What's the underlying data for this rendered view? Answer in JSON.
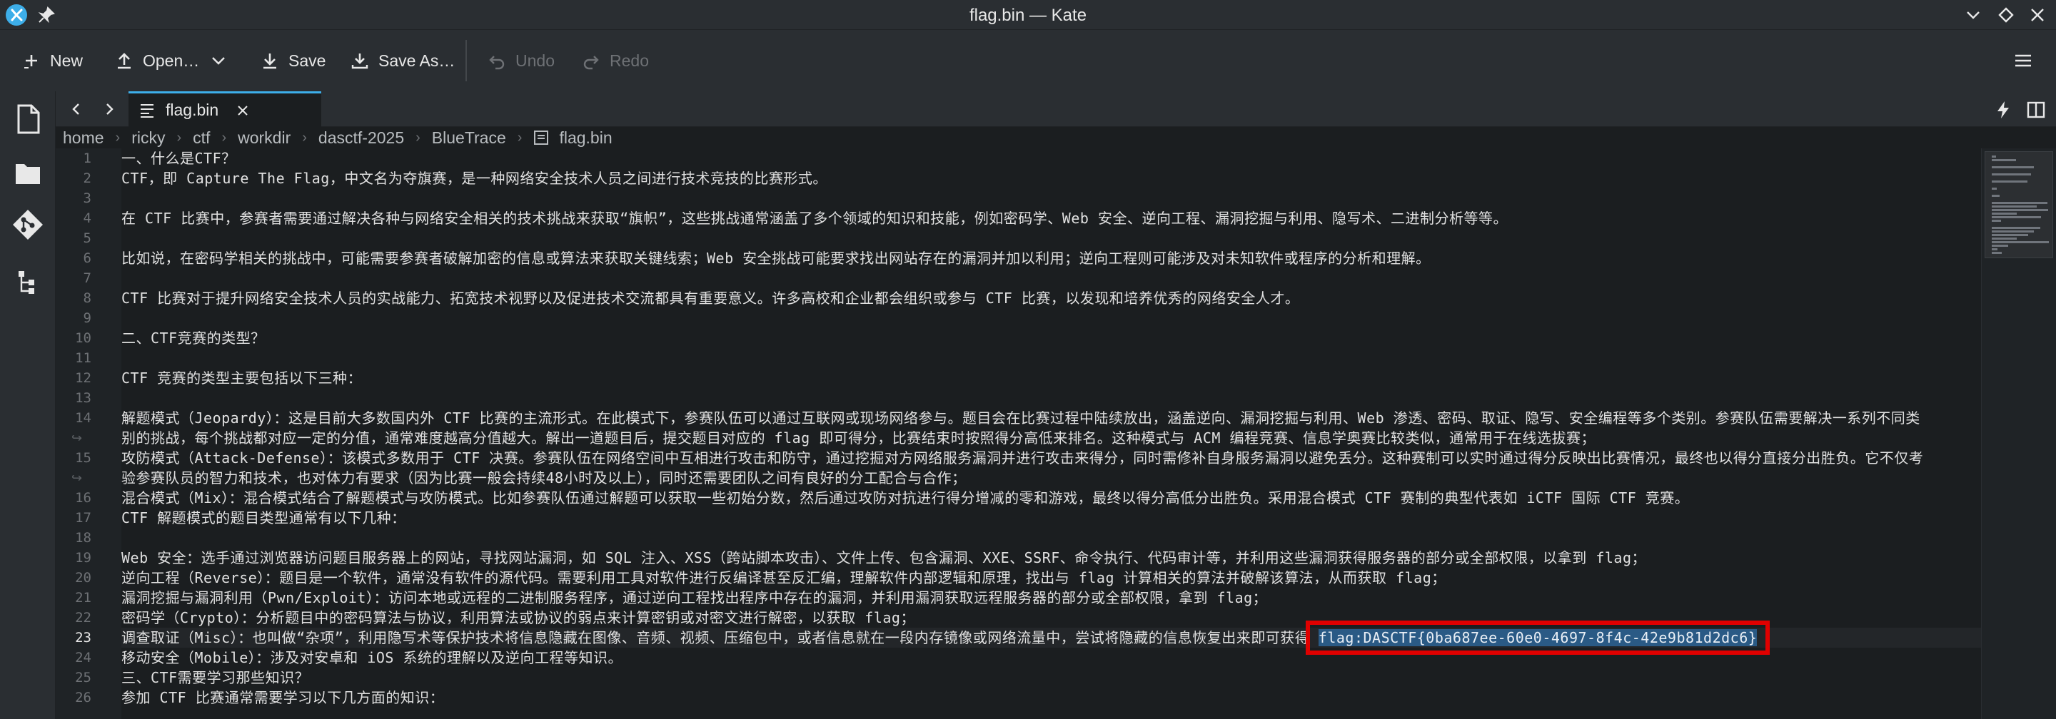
{
  "window": {
    "title": "flag.bin — Kate"
  },
  "toolbar": {
    "new_label": "New",
    "open_label": "Open…",
    "save_label": "Save",
    "save_as_label": "Save As…",
    "undo_label": "Undo",
    "redo_label": "Redo"
  },
  "tab": {
    "label": "flag.bin"
  },
  "breadcrumb": [
    "home",
    "ricky",
    "ctf",
    "workdir",
    "dasctf-2025",
    "BlueTrace",
    "flag.bin"
  ],
  "editor": {
    "current_line": 23,
    "rows": [
      {
        "num": "1",
        "text": "一、什么是CTF？"
      },
      {
        "num": "2",
        "text": "CTF，即 Capture The Flag，中文名为夺旗赛，是一种网络安全技术人员之间进行技术竞技的比赛形式。"
      },
      {
        "num": "3",
        "text": ""
      },
      {
        "num": "4",
        "text": "在 CTF 比赛中，参赛者需要通过解决各种与网络安全相关的技术挑战来获取“旗帜”，这些挑战通常涵盖了多个领域的知识和技能，例如密码学、Web 安全、逆向工程、漏洞挖掘与利用、隐写术、二进制分析等等。"
      },
      {
        "num": "5",
        "text": ""
      },
      {
        "num": "6",
        "text": "比如说，在密码学相关的挑战中，可能需要参赛者破解加密的信息或算法来获取关键线索；Web 安全挑战可能要求找出网站存在的漏洞并加以利用；逆向工程则可能涉及对未知软件或程序的分析和理解。"
      },
      {
        "num": "7",
        "text": ""
      },
      {
        "num": "8",
        "text": "CTF 比赛对于提升网络安全技术人员的实战能力、拓宽技术视野以及促进技术交流都具有重要意义。许多高校和企业都会组织或参与 CTF 比赛，以发现和培养优秀的网络安全人才。"
      },
      {
        "num": "9",
        "text": ""
      },
      {
        "num": "10",
        "text": "二、CTF竞赛的类型？"
      },
      {
        "num": "11",
        "text": ""
      },
      {
        "num": "12",
        "text": "CTF 竞赛的类型主要包括以下三种："
      },
      {
        "num": "13",
        "text": ""
      },
      {
        "num": "14",
        "text": "解题模式（Jeopardy）：这是目前大多数国内外 CTF 比赛的主流形式。在此模式下，参赛队伍可以通过互联网或现场网络参与。题目会在比赛过程中陆续放出，涵盖逆向、漏洞挖掘与利用、Web 渗透、密码、取证、隐写、安全编程等多个类别。参赛队伍需要解决一系列不同类"
      },
      {
        "num": "",
        "wrap": true,
        "text": "别的挑战，每个挑战都对应一定的分值，通常难度越高分值越大。解出一道题目后，提交题目对应的 flag 即可得分，比赛结束时按照得分高低来排名。这种模式与 ACM 编程竞赛、信息学奥赛比较类似，通常用于在线选拔赛；"
      },
      {
        "num": "15",
        "text": "攻防模式（Attack-Defense）：该模式多数用于 CTF 决赛。参赛队伍在网络空间中互相进行攻击和防守，通过挖掘对方网络服务漏洞并进行攻击来得分，同时需修补自身服务漏洞以避免丢分。这种赛制可以实时通过得分反映出比赛情况，最终也以得分直接分出胜负。它不仅考"
      },
      {
        "num": "",
        "wrap": true,
        "text": "验参赛队员的智力和技术，也对体力有要求（因为比赛一般会持续48小时及以上），同时还需要团队之间有良好的分工配合与合作；"
      },
      {
        "num": "16",
        "text": "混合模式（Mix）：混合模式结合了解题模式与攻防模式。比如参赛队伍通过解题可以获取一些初始分数，然后通过攻防对抗进行得分增减的零和游戏，最终以得分高低分出胜负。采用混合模式 CTF 赛制的典型代表如 iCTF 国际 CTF 竞赛。"
      },
      {
        "num": "17",
        "text": "CTF 解题模式的题目类型通常有以下几种："
      },
      {
        "num": "18",
        "text": ""
      },
      {
        "num": "19",
        "text": "Web 安全：选手通过浏览器访问题目服务器上的网站，寻找网站漏洞，如 SQL 注入、XSS（跨站脚本攻击）、文件上传、包含漏洞、XXE、SSRF、命令执行、代码审计等，并利用这些漏洞获得服务器的部分或全部权限，以拿到 flag；"
      },
      {
        "num": "20",
        "text": "逆向工程（Reverse）：题目是一个软件，通常没有软件的源代码。需要利用工具对软件进行反编译甚至反汇编，理解软件内部逻辑和原理，找出与 flag 计算相关的算法并破解该算法，从而获取 flag；"
      },
      {
        "num": "21",
        "text": "漏洞挖掘与漏洞利用（Pwn/Exploit）：访问本地或远程的二进制服务程序，通过逆向工程找出程序中存在的漏洞，并利用漏洞获取远程服务器的部分或全部权限，拿到 flag；"
      },
      {
        "num": "22",
        "text": "密码学（Crypto）：分析题目中的密码算法与协议，利用算法或协议的弱点来计算密钥或对密文进行解密，以获取 flag；"
      },
      {
        "num": "23",
        "text": "调查取证（Misc）：也叫做“杂项”，利用隐写术等保护技术将信息隐藏在图像、音频、视频、压缩包中，或者信息就在一段内存镜像或网络流量中，尝试将隐藏的信息恢复出来即可获得 ",
        "selected": "flag:DASCTF{0ba687ee-60e0-4697-8f4c-42e9b81d2dc6}"
      },
      {
        "num": "24",
        "text": "移动安全（Mobile）：涉及对安卓和 iOS 系统的理解以及逆向工程等知识。"
      },
      {
        "num": "25",
        "text": "三、CTF需要学习那些知识？"
      },
      {
        "num": "26",
        "text": "参加 CTF 比赛通常需要学习以下几方面的知识："
      }
    ]
  },
  "colors": {
    "accent": "#3daee9",
    "selection": "#2a5a85",
    "highlight_box": "#e00000"
  }
}
